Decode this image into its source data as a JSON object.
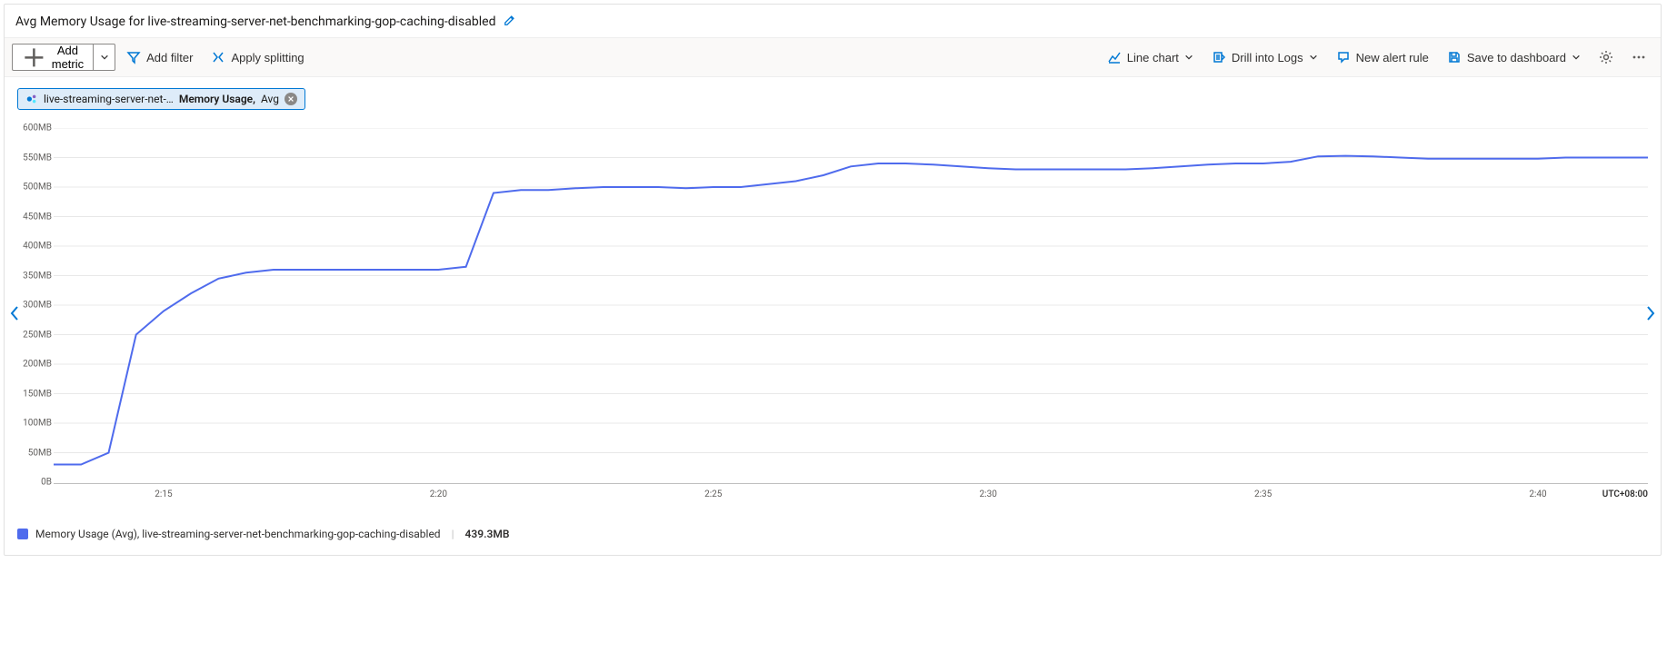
{
  "title": "Avg Memory Usage for live-streaming-server-net-benchmarking-gop-caching-disabled",
  "toolbar": {
    "add_metric": "Add metric",
    "add_filter": "Add filter",
    "apply_splitting": "Apply splitting",
    "chart_type": "Line chart",
    "drill_logs": "Drill into Logs",
    "new_alert": "New alert rule",
    "save_dash": "Save to dashboard"
  },
  "chip": {
    "resource": "live-streaming-server-net-…",
    "metric": "Memory Usage,",
    "agg": "Avg"
  },
  "legend": {
    "series": "Memory Usage (Avg), live-streaming-server-net-benchmarking-gop-caching-disabled",
    "value": "439.3MB"
  },
  "timezone": "UTC+08:00",
  "colors": {
    "series": "#4f6bed"
  },
  "chart_data": {
    "type": "line",
    "y_unit": "MB",
    "ylim": [
      0,
      600
    ],
    "y_ticks": [
      0,
      50,
      100,
      150,
      200,
      250,
      300,
      350,
      400,
      450,
      500,
      550,
      600
    ],
    "y_tick_labels": [
      "0B",
      "50MB",
      "100MB",
      "150MB",
      "200MB",
      "250MB",
      "300MB",
      "350MB",
      "400MB",
      "450MB",
      "500MB",
      "550MB",
      "600MB"
    ],
    "x_ticks": [
      "2:15",
      "2:20",
      "2:25",
      "2:30",
      "2:35",
      "2:40"
    ],
    "x": [
      "2:13:00",
      "2:13:30",
      "2:14:00",
      "2:14:30",
      "2:15:00",
      "2:15:30",
      "2:16:00",
      "2:16:30",
      "2:17:00",
      "2:17:30",
      "2:18:00",
      "2:18:30",
      "2:19:00",
      "2:19:30",
      "2:20:00",
      "2:20:30",
      "2:21:00",
      "2:21:30",
      "2:22:00",
      "2:22:30",
      "2:23:00",
      "2:23:30",
      "2:24:00",
      "2:24:30",
      "2:25:00",
      "2:25:30",
      "2:26:00",
      "2:26:30",
      "2:27:00",
      "2:27:30",
      "2:28:00",
      "2:28:30",
      "2:29:00",
      "2:29:30",
      "2:30:00",
      "2:30:30",
      "2:31:00",
      "2:31:30",
      "2:32:00",
      "2:32:30",
      "2:33:00",
      "2:33:30",
      "2:34:00",
      "2:34:30",
      "2:35:00",
      "2:35:30",
      "2:36:00",
      "2:36:30",
      "2:37:00",
      "2:37:30",
      "2:38:00",
      "2:38:30",
      "2:39:00",
      "2:39:30",
      "2:40:00",
      "2:40:30",
      "2:41:00",
      "2:41:30",
      "2:42:00"
    ],
    "series": [
      {
        "name": "Memory Usage (Avg)",
        "color": "#4f6bed",
        "values": [
          30,
          30,
          50,
          250,
          290,
          320,
          345,
          355,
          360,
          360,
          360,
          360,
          360,
          360,
          360,
          365,
          490,
          495,
          495,
          498,
          500,
          500,
          500,
          498,
          500,
          500,
          505,
          510,
          520,
          535,
          540,
          540,
          538,
          535,
          532,
          530,
          530,
          530,
          530,
          530,
          532,
          535,
          538,
          540,
          540,
          543,
          552,
          553,
          552,
          550,
          548,
          548,
          548,
          548,
          548,
          550,
          550,
          550,
          550
        ]
      }
    ]
  }
}
